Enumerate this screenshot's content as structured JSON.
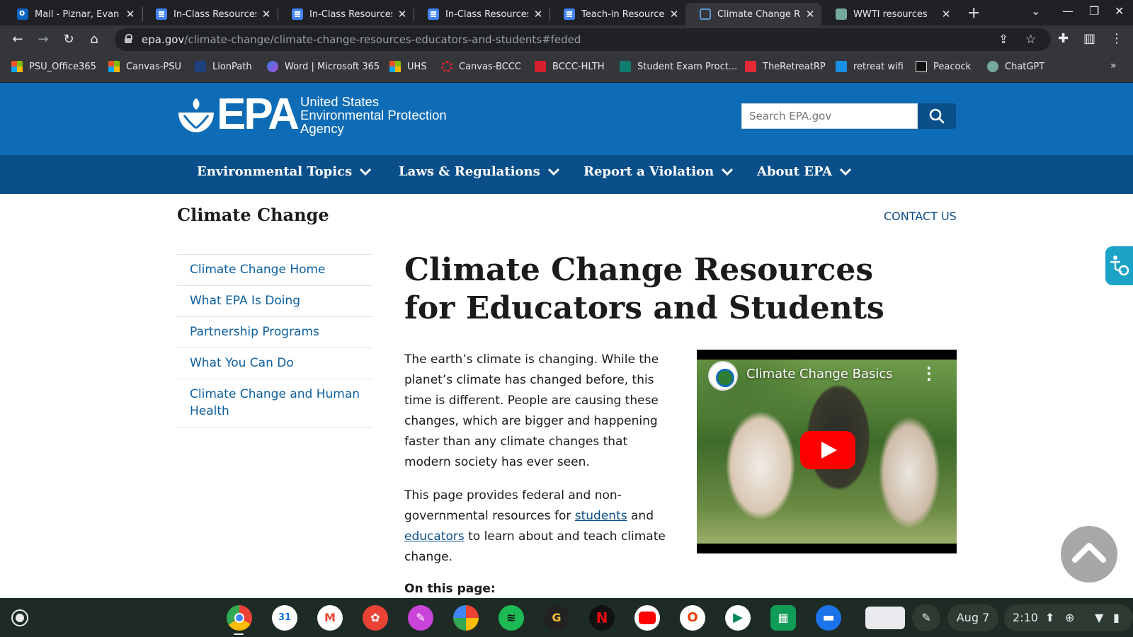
{
  "browser": {
    "tabs": [
      {
        "label": "Mail - Piznar, Evan",
        "icon": "outlook-icon",
        "active": false
      },
      {
        "label": "In-Class Resources",
        "icon": "docs-icon",
        "active": false
      },
      {
        "label": "In-Class Resources",
        "icon": "docs-icon",
        "active": false
      },
      {
        "label": "In-Class Resources",
        "icon": "docs-icon",
        "active": false
      },
      {
        "label": "Teach-in Resources",
        "icon": "docs-icon",
        "active": false
      },
      {
        "label": "Climate Change Re",
        "icon": "epa-icon",
        "active": true
      },
      {
        "label": "WWTI resources",
        "icon": "chatgpt-icon",
        "active": false
      }
    ],
    "url_host": "epa.gov",
    "url_path": "/climate-change/climate-change-resources-educators-and-students#feded",
    "bookmarks": [
      {
        "label": "PSU_Office365",
        "icon": "microsoft-icon"
      },
      {
        "label": "Canvas-PSU",
        "icon": "microsoft-icon"
      },
      {
        "label": "LionPath",
        "icon": "lionpath-icon"
      },
      {
        "label": "Word | Microsoft 365",
        "icon": "copilot-icon"
      },
      {
        "label": "UHS",
        "icon": "microsoft-icon"
      },
      {
        "label": "Canvas-BCCC",
        "icon": "canvas-icon"
      },
      {
        "label": "BCCC-HLTH",
        "icon": "mcgraw-icon"
      },
      {
        "label": "Student Exam Proct...",
        "icon": "forms-icon"
      },
      {
        "label": "TheRetreatRP",
        "icon": "retreat-icon"
      },
      {
        "label": "retreat wifi",
        "icon": "wifi-bookmark-icon"
      },
      {
        "label": "Peacock",
        "icon": "peacock-icon"
      },
      {
        "label": "ChatGPT",
        "icon": "chatgpt-icon"
      }
    ]
  },
  "header": {
    "logo_text": "EPA",
    "agency_lines": [
      "United States",
      "Environmental Protection",
      "Agency"
    ],
    "search_placeholder": "Search EPA.gov"
  },
  "nav": {
    "items": [
      "Environmental Topics",
      "Laws & Regulations",
      "Report a Violation",
      "About EPA"
    ]
  },
  "page": {
    "site_title": "Climate Change",
    "contact": "CONTACT US",
    "sidenav": [
      "Climate Change Home",
      "What EPA Is Doing",
      "Partnership Programs",
      "What You Can Do",
      "Climate Change and Human Health"
    ],
    "title": "Climate Change Resources for Educators and Students",
    "intro": "The earth’s climate is changing. While the planet’s climate has changed before, this time is different. People are causing these changes, which are bigger and happening faster than any climate changes that modern society has ever seen.",
    "intro2_before": "This page provides federal and non-governmental resources for ",
    "intro2_link1": "students",
    "intro2_mid": " and ",
    "intro2_link2": "educators",
    "intro2_after": " to learn about and teach climate change.",
    "on_this_page": "On this page:",
    "video_title": "Climate Change Basics"
  },
  "shelf": {
    "date": "Aug 7",
    "time": "2:10"
  },
  "colors": {
    "epa_blue": "#0e6cb6",
    "epa_nav": "#0b4f8a",
    "link": "#0b5f9e"
  }
}
